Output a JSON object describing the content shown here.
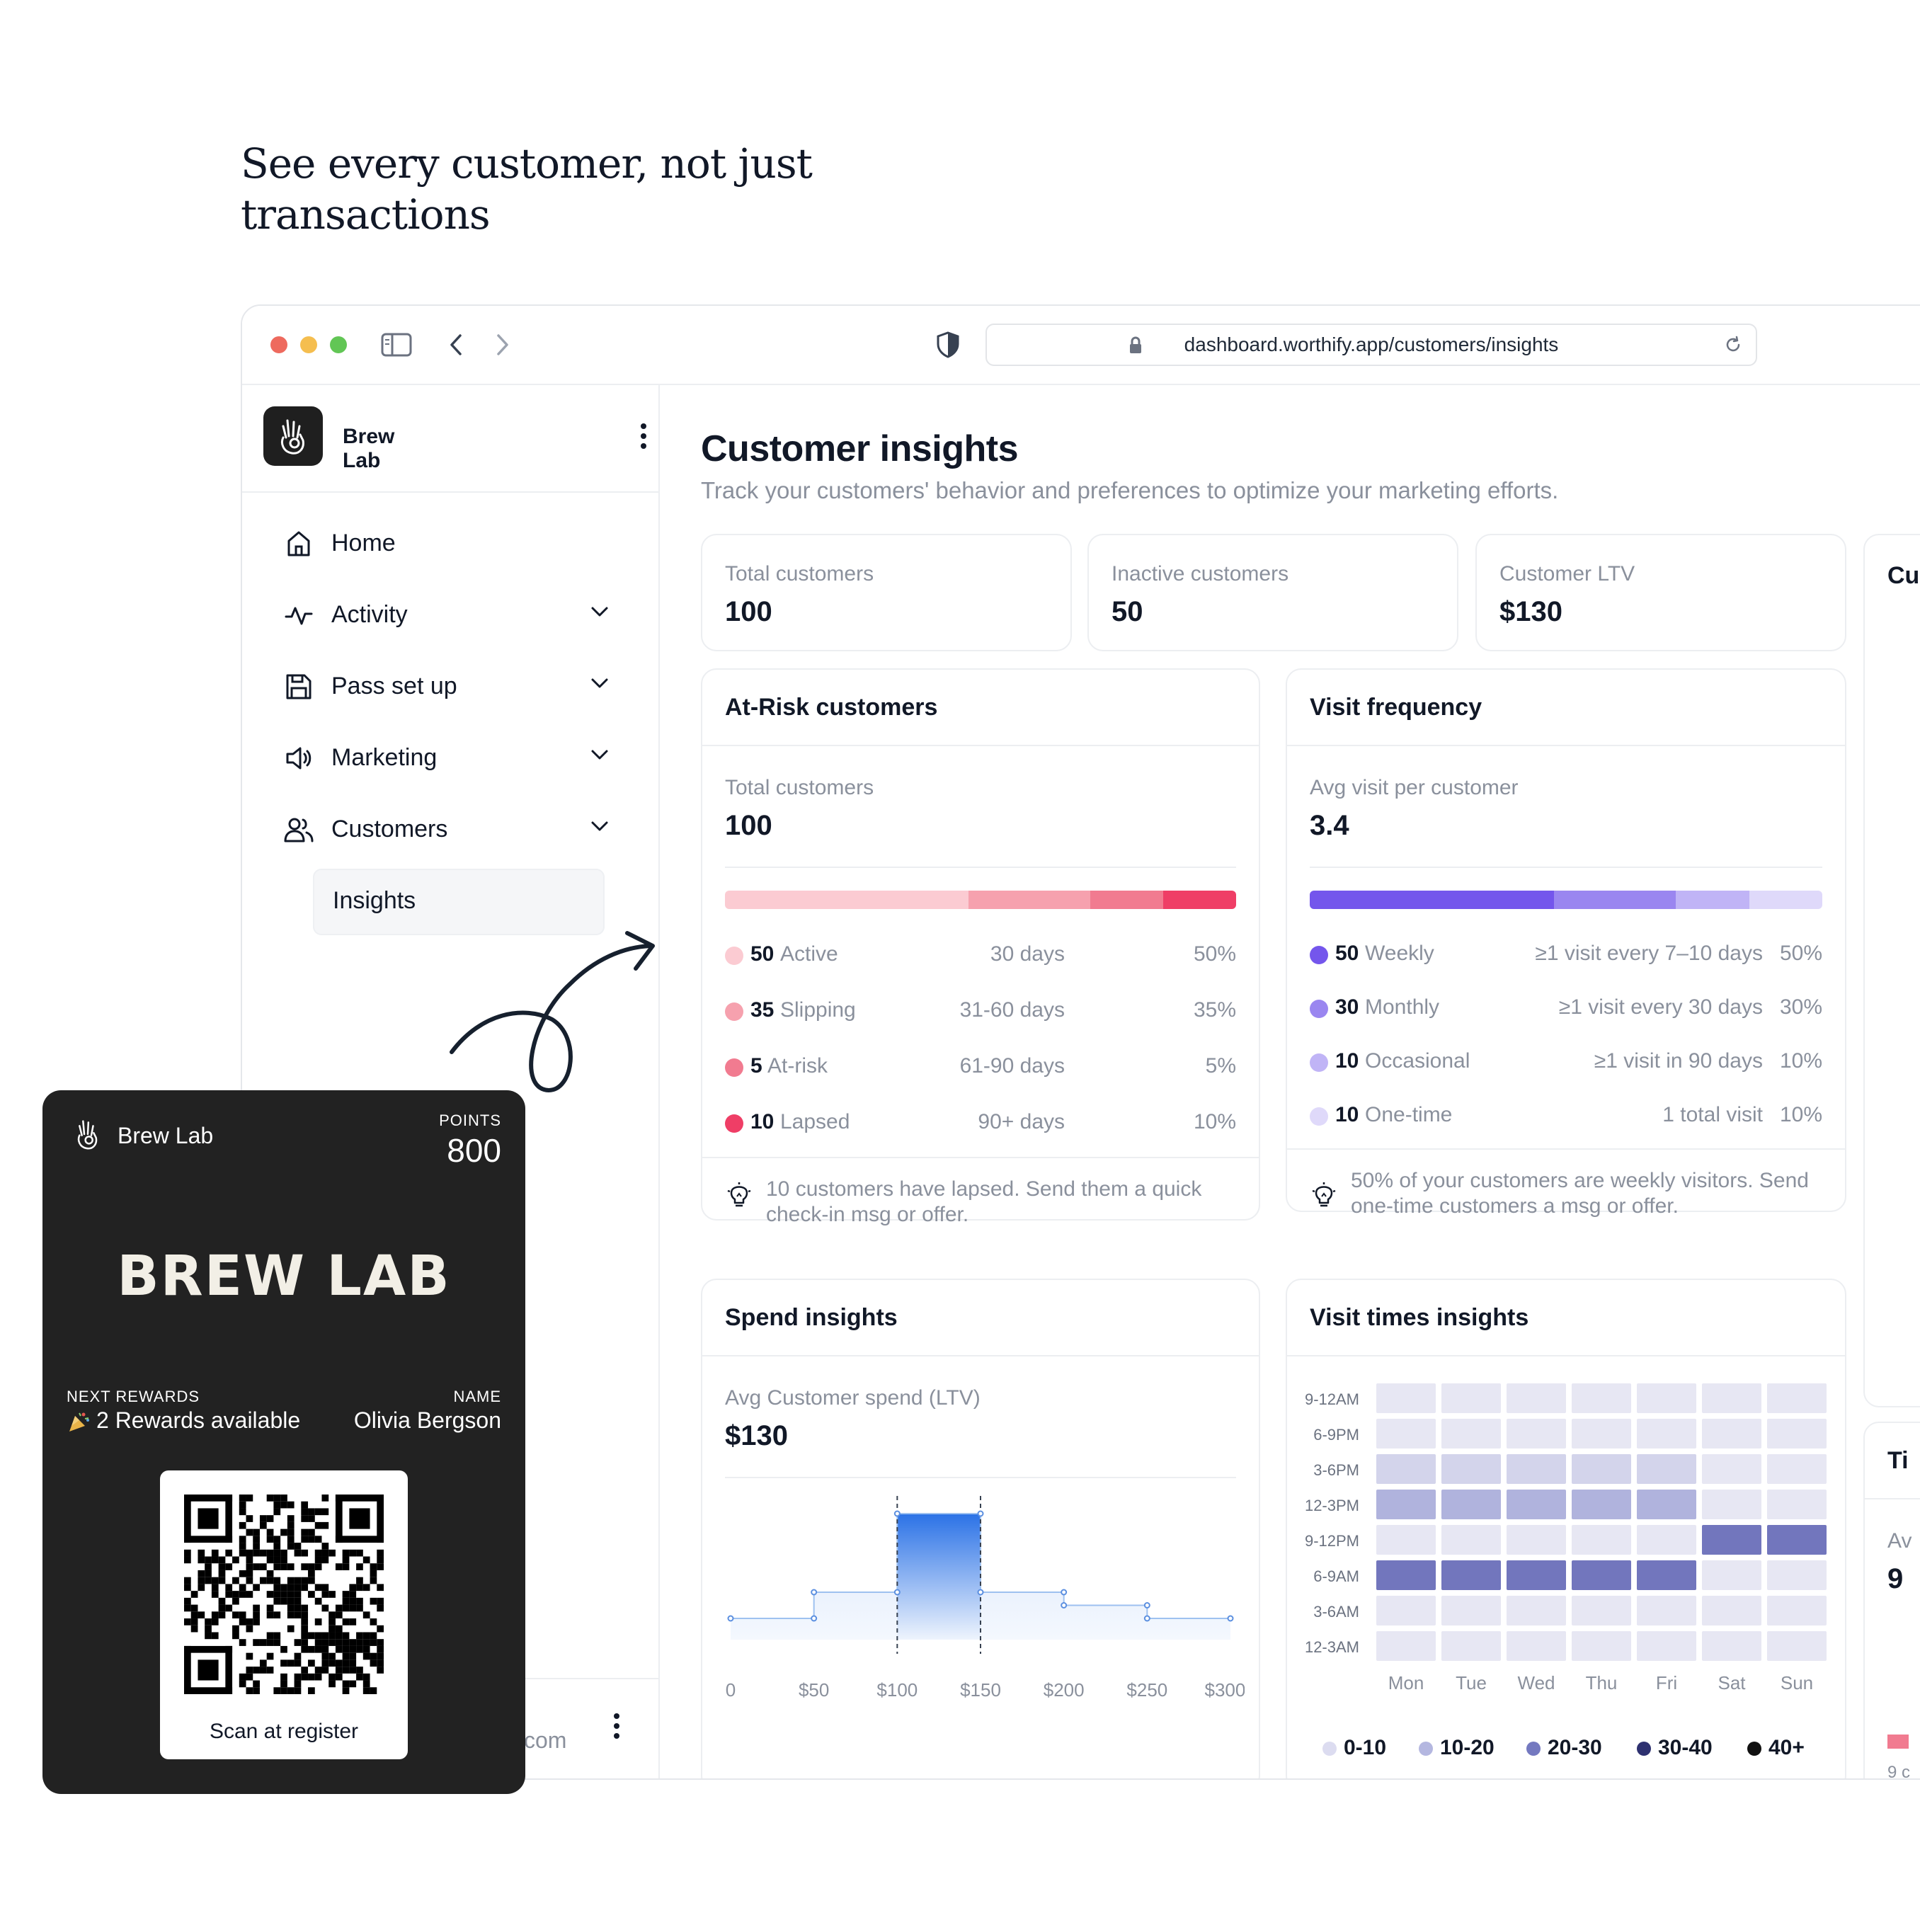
{
  "headline": "See every customer, not just transactions",
  "browser": {
    "url": "dashboard.worthify.app/customers/insights"
  },
  "sidebar": {
    "brand_name": "Brew Lab",
    "items": [
      {
        "label": "Home",
        "icon": "home-icon"
      },
      {
        "label": "Activity",
        "icon": "activity-icon"
      },
      {
        "label": "Pass set up",
        "icon": "save-icon"
      },
      {
        "label": "Marketing",
        "icon": "megaphone-icon"
      },
      {
        "label": "Customers",
        "icon": "users-icon"
      }
    ],
    "sub_item": "Insights",
    "footer_text": "com"
  },
  "page": {
    "title": "Customer insights",
    "subtitle": "Track your customers' behavior and preferences to optimize your marketing efforts."
  },
  "stats": [
    {
      "label": "Total customers",
      "value": "100"
    },
    {
      "label": "Inactive customers",
      "value": "50"
    },
    {
      "label": "Customer LTV",
      "value": "$130"
    }
  ],
  "at_risk": {
    "title": "At-Risk customers",
    "label": "Total customers",
    "value": "100",
    "rows": [
      {
        "count": "50",
        "name": "Active",
        "range": "30 days",
        "pct": "50%",
        "color": "#fbcbd2",
        "share": 0.5
      },
      {
        "count": "35",
        "name": "Slipping",
        "range": "31-60 days",
        "pct": "35%",
        "color": "#f6a1ae",
        "share": 0.25
      },
      {
        "count": "5",
        "name": "At-risk",
        "range": "61-90 days",
        "pct": "5%",
        "color": "#f17b90",
        "share": 0.15
      },
      {
        "count": "10",
        "name": "Lapsed",
        "range": "90+ days",
        "pct": "10%",
        "color": "#ef3e66",
        "share": 0.15
      }
    ],
    "tip": "10 customers have lapsed. Send them a quick check-in msg or offer."
  },
  "visit_frequency": {
    "title": "Visit frequency",
    "label": "Avg visit per customer",
    "value": "3.4",
    "rows": [
      {
        "count": "50",
        "name": "Weekly",
        "range": "≥1 visit every 7–10 days",
        "pct": "50%",
        "color": "#7456ec",
        "share": 0.5
      },
      {
        "count": "30",
        "name": "Monthly",
        "range": "≥1 visit every 30 days",
        "pct": "30%",
        "color": "#9a86f0",
        "share": 0.25
      },
      {
        "count": "10",
        "name": "Occasional",
        "range": "≥1 visit in 90 days",
        "pct": "10%",
        "color": "#c0b4f6",
        "share": 0.15
      },
      {
        "count": "10",
        "name": "One-time",
        "range": "1 total visit",
        "pct": "10%",
        "color": "#dfd9fa",
        "share": 0.15
      }
    ],
    "tip": "50% of your customers are weekly visitors. Send one-time customers a msg or offer."
  },
  "spend": {
    "title": "Spend insights",
    "label": "Avg Customer spend (LTV)",
    "value": "$130",
    "chart_data": {
      "type": "area",
      "x": [
        "0",
        "$50",
        "$100",
        "$150",
        "$200",
        "$250",
        "$300+"
      ],
      "values": [
        0,
        2,
        8,
        2,
        1,
        0
      ],
      "xlabel": "",
      "ylabel": ""
    }
  },
  "visit_times": {
    "title": "Visit times insights",
    "chart_data": {
      "type": "heatmap",
      "rows": [
        "9-12AM",
        "6-9PM",
        "3-6PM",
        "12-3PM",
        "9-12PM",
        "6-9AM",
        "3-6AM",
        "12-3AM"
      ],
      "columns": [
        "Mon",
        "Tue",
        "Wed",
        "Thu",
        "Fri",
        "Sat",
        "Sun"
      ],
      "values": [
        [
          0,
          0,
          0,
          0,
          0,
          0,
          0
        ],
        [
          0,
          0,
          0,
          0,
          0,
          0,
          0
        ],
        [
          1,
          1,
          1,
          1,
          1,
          0,
          0
        ],
        [
          2,
          2,
          2,
          2,
          2,
          0,
          0
        ],
        [
          0,
          0,
          0,
          0,
          0,
          3,
          3
        ],
        [
          3,
          3,
          3,
          3,
          3,
          0,
          0
        ],
        [
          0,
          0,
          0,
          0,
          0,
          0,
          0
        ],
        [
          0,
          0,
          0,
          0,
          0,
          0,
          0
        ]
      ],
      "legend": [
        "0-10",
        "10-20",
        "20-30",
        "30-40",
        "40+"
      ],
      "legend_colors": [
        "#dcdcf0",
        "#b4b7e0",
        "#7479c0",
        "#2e3170",
        "#111111"
      ]
    }
  },
  "right_edge": {
    "stat_partial": "Cu",
    "card_partial": "Ti",
    "sub_partial": "Av",
    "value_partial": "9",
    "tick_partial": "9 c"
  },
  "pass": {
    "brand": "Brew Lab",
    "points_label": "POINTS",
    "points": "800",
    "wordmark": "BREW LAB",
    "next_rewards_label": "NEXT REWARDS",
    "next_rewards": "2 Rewards available",
    "name_label": "NAME",
    "name": "Olivia Bergson",
    "scan_caption": "Scan at register"
  }
}
